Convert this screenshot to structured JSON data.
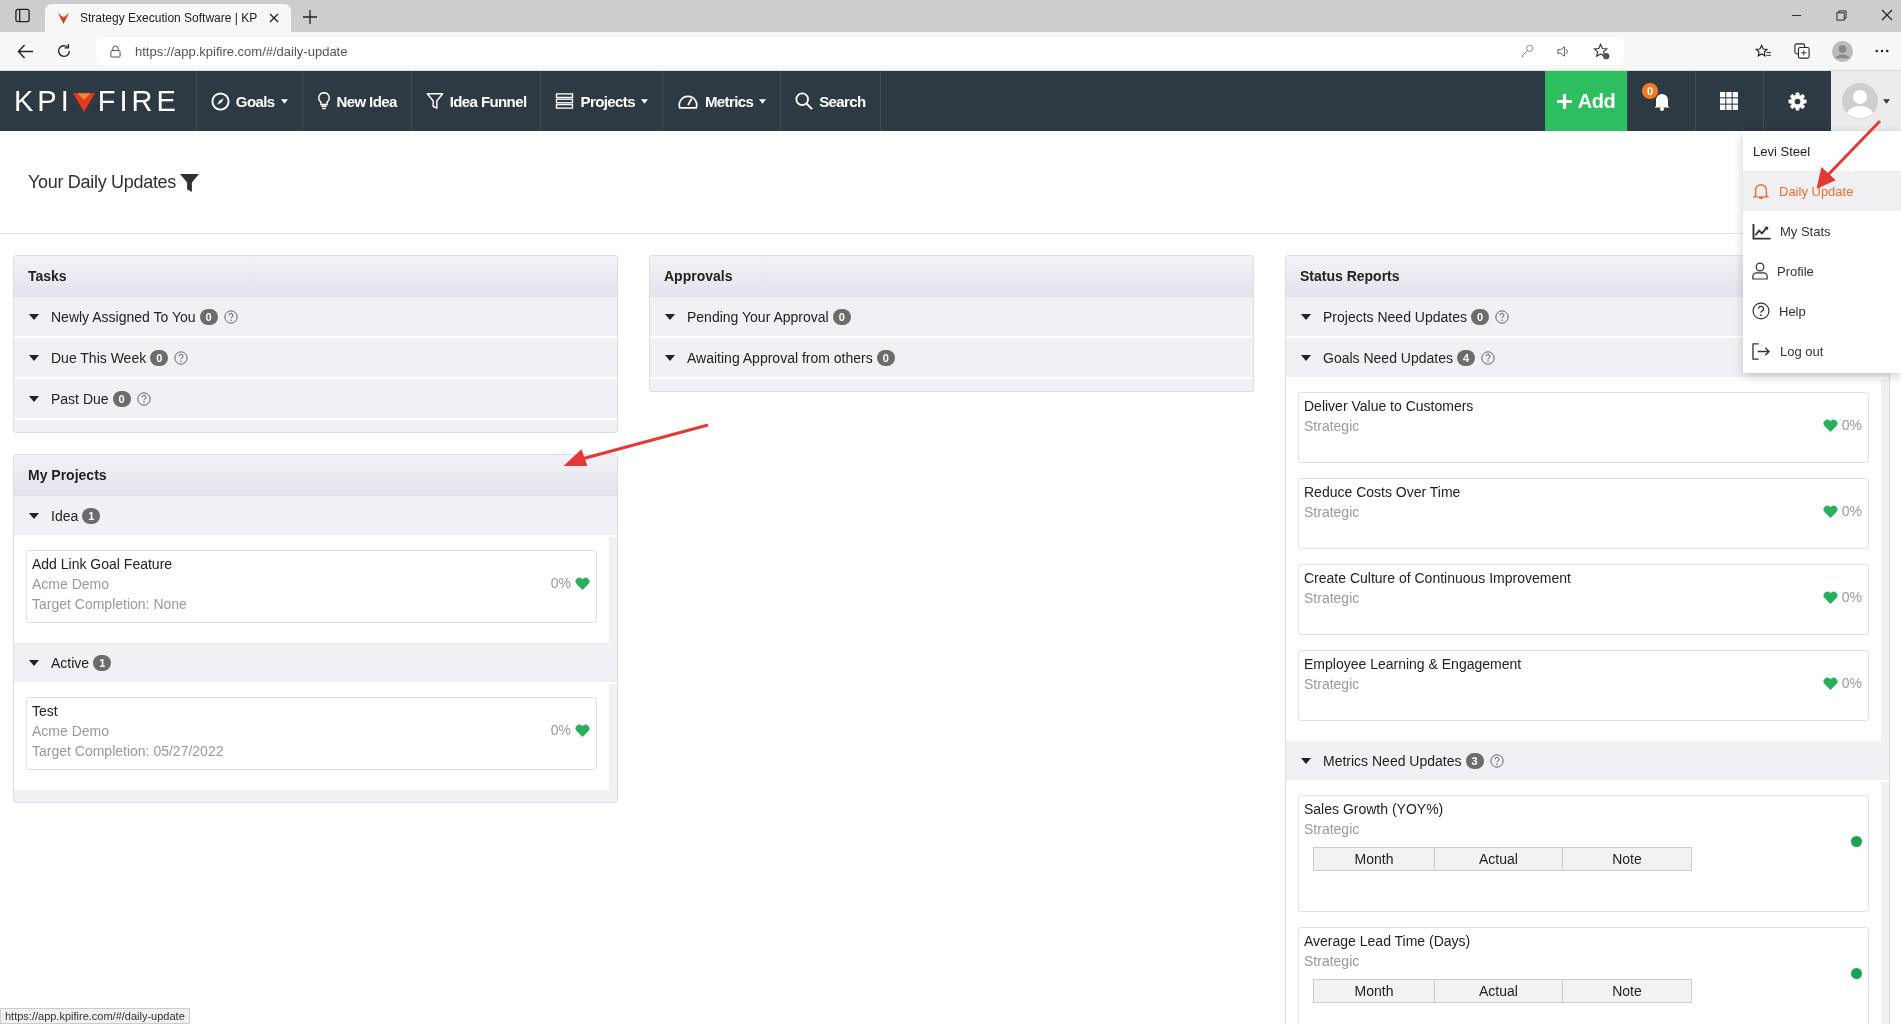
{
  "browser": {
    "tab_title": "Strategy Execution Software | KP",
    "url": "https://app.kpifire.com/#/daily-update"
  },
  "nav": {
    "logo_parts": [
      "KPI",
      "FIRE"
    ],
    "items": [
      {
        "label": "Goals",
        "dropdown": true
      },
      {
        "label": "New Idea",
        "dropdown": false
      },
      {
        "label": "Idea Funnel",
        "dropdown": false
      },
      {
        "label": "Projects",
        "dropdown": true
      },
      {
        "label": "Metrics",
        "dropdown": true
      },
      {
        "label": "Search",
        "dropdown": false
      }
    ],
    "add_label": "Add",
    "notification_count": "0"
  },
  "user_menu": {
    "name": "Levi Steel",
    "items": [
      {
        "label": "Daily Update",
        "selected": true
      },
      {
        "label": "My Stats",
        "selected": false
      },
      {
        "label": "Profile",
        "selected": false
      },
      {
        "label": "Help",
        "selected": false
      },
      {
        "label": "Log out",
        "selected": false
      }
    ]
  },
  "page": {
    "title": "Your Daily Updates"
  },
  "columns": [
    {
      "panels": [
        {
          "title": "Tasks",
          "sections": [
            {
              "label": "Newly Assigned To You",
              "count": "0",
              "help": true,
              "expanded": true
            },
            {
              "label": "Due This Week",
              "count": "0",
              "help": true,
              "expanded": true
            },
            {
              "label": "Past Due",
              "count": "0",
              "help": true,
              "expanded": true
            }
          ]
        },
        {
          "title": "My Projects",
          "sections": [
            {
              "label": "Idea",
              "count": "1",
              "help": false,
              "expanded": true,
              "items": [
                {
                  "kind": "project",
                  "title": "Add Link Goal Feature",
                  "org": "Acme Demo",
                  "target": "Target Completion: None",
                  "progress": "0%"
                }
              ]
            },
            {
              "label": "Active",
              "count": "1",
              "help": false,
              "expanded": true,
              "items": [
                {
                  "kind": "project",
                  "title": "Test",
                  "org": "Acme Demo",
                  "target": "Target Completion: 05/27/2022",
                  "progress": "0%"
                }
              ]
            }
          ]
        }
      ]
    },
    {
      "panels": [
        {
          "title": "Approvals",
          "sections": [
            {
              "label": "Pending Your Approval",
              "count": "0",
              "help": false,
              "expanded": true
            },
            {
              "label": "Awaiting Approval from others",
              "count": "0",
              "help": false,
              "expanded": true
            }
          ]
        }
      ]
    },
    {
      "panels": [
        {
          "title": "Status Reports",
          "sections": [
            {
              "label": "Projects Need Updates",
              "count": "0",
              "help": true,
              "expanded": true
            },
            {
              "label": "Goals Need Updates",
              "count": "4",
              "help": true,
              "expanded": true,
              "items": [
                {
                  "kind": "goal",
                  "title": "Deliver Value to Customers",
                  "type": "Strategic",
                  "progress": "0%"
                },
                {
                  "kind": "goal",
                  "title": "Reduce Costs Over Time",
                  "type": "Strategic",
                  "progress": "0%"
                },
                {
                  "kind": "goal",
                  "title": "Create Culture of Continuous Improvement",
                  "type": "Strategic",
                  "progress": "0%"
                },
                {
                  "kind": "goal",
                  "title": "Employee Learning & Engagement",
                  "type": "Strategic",
                  "progress": "0%"
                }
              ]
            },
            {
              "label": "Metrics Need Updates",
              "count": "3",
              "help": true,
              "expanded": true,
              "items": [
                {
                  "kind": "metric",
                  "title": "Sales Growth (YOY%)",
                  "type": "Strategic",
                  "table_columns": [
                    "Month",
                    "Actual",
                    "Note"
                  ]
                },
                {
                  "kind": "metric",
                  "title": "Average Lead Time (Days)",
                  "type": "Strategic",
                  "table_columns": [
                    "Month",
                    "Actual",
                    "Note"
                  ]
                }
              ]
            }
          ]
        }
      ]
    }
  ],
  "status_url": "https://app.kpifire.com/#/daily-update"
}
